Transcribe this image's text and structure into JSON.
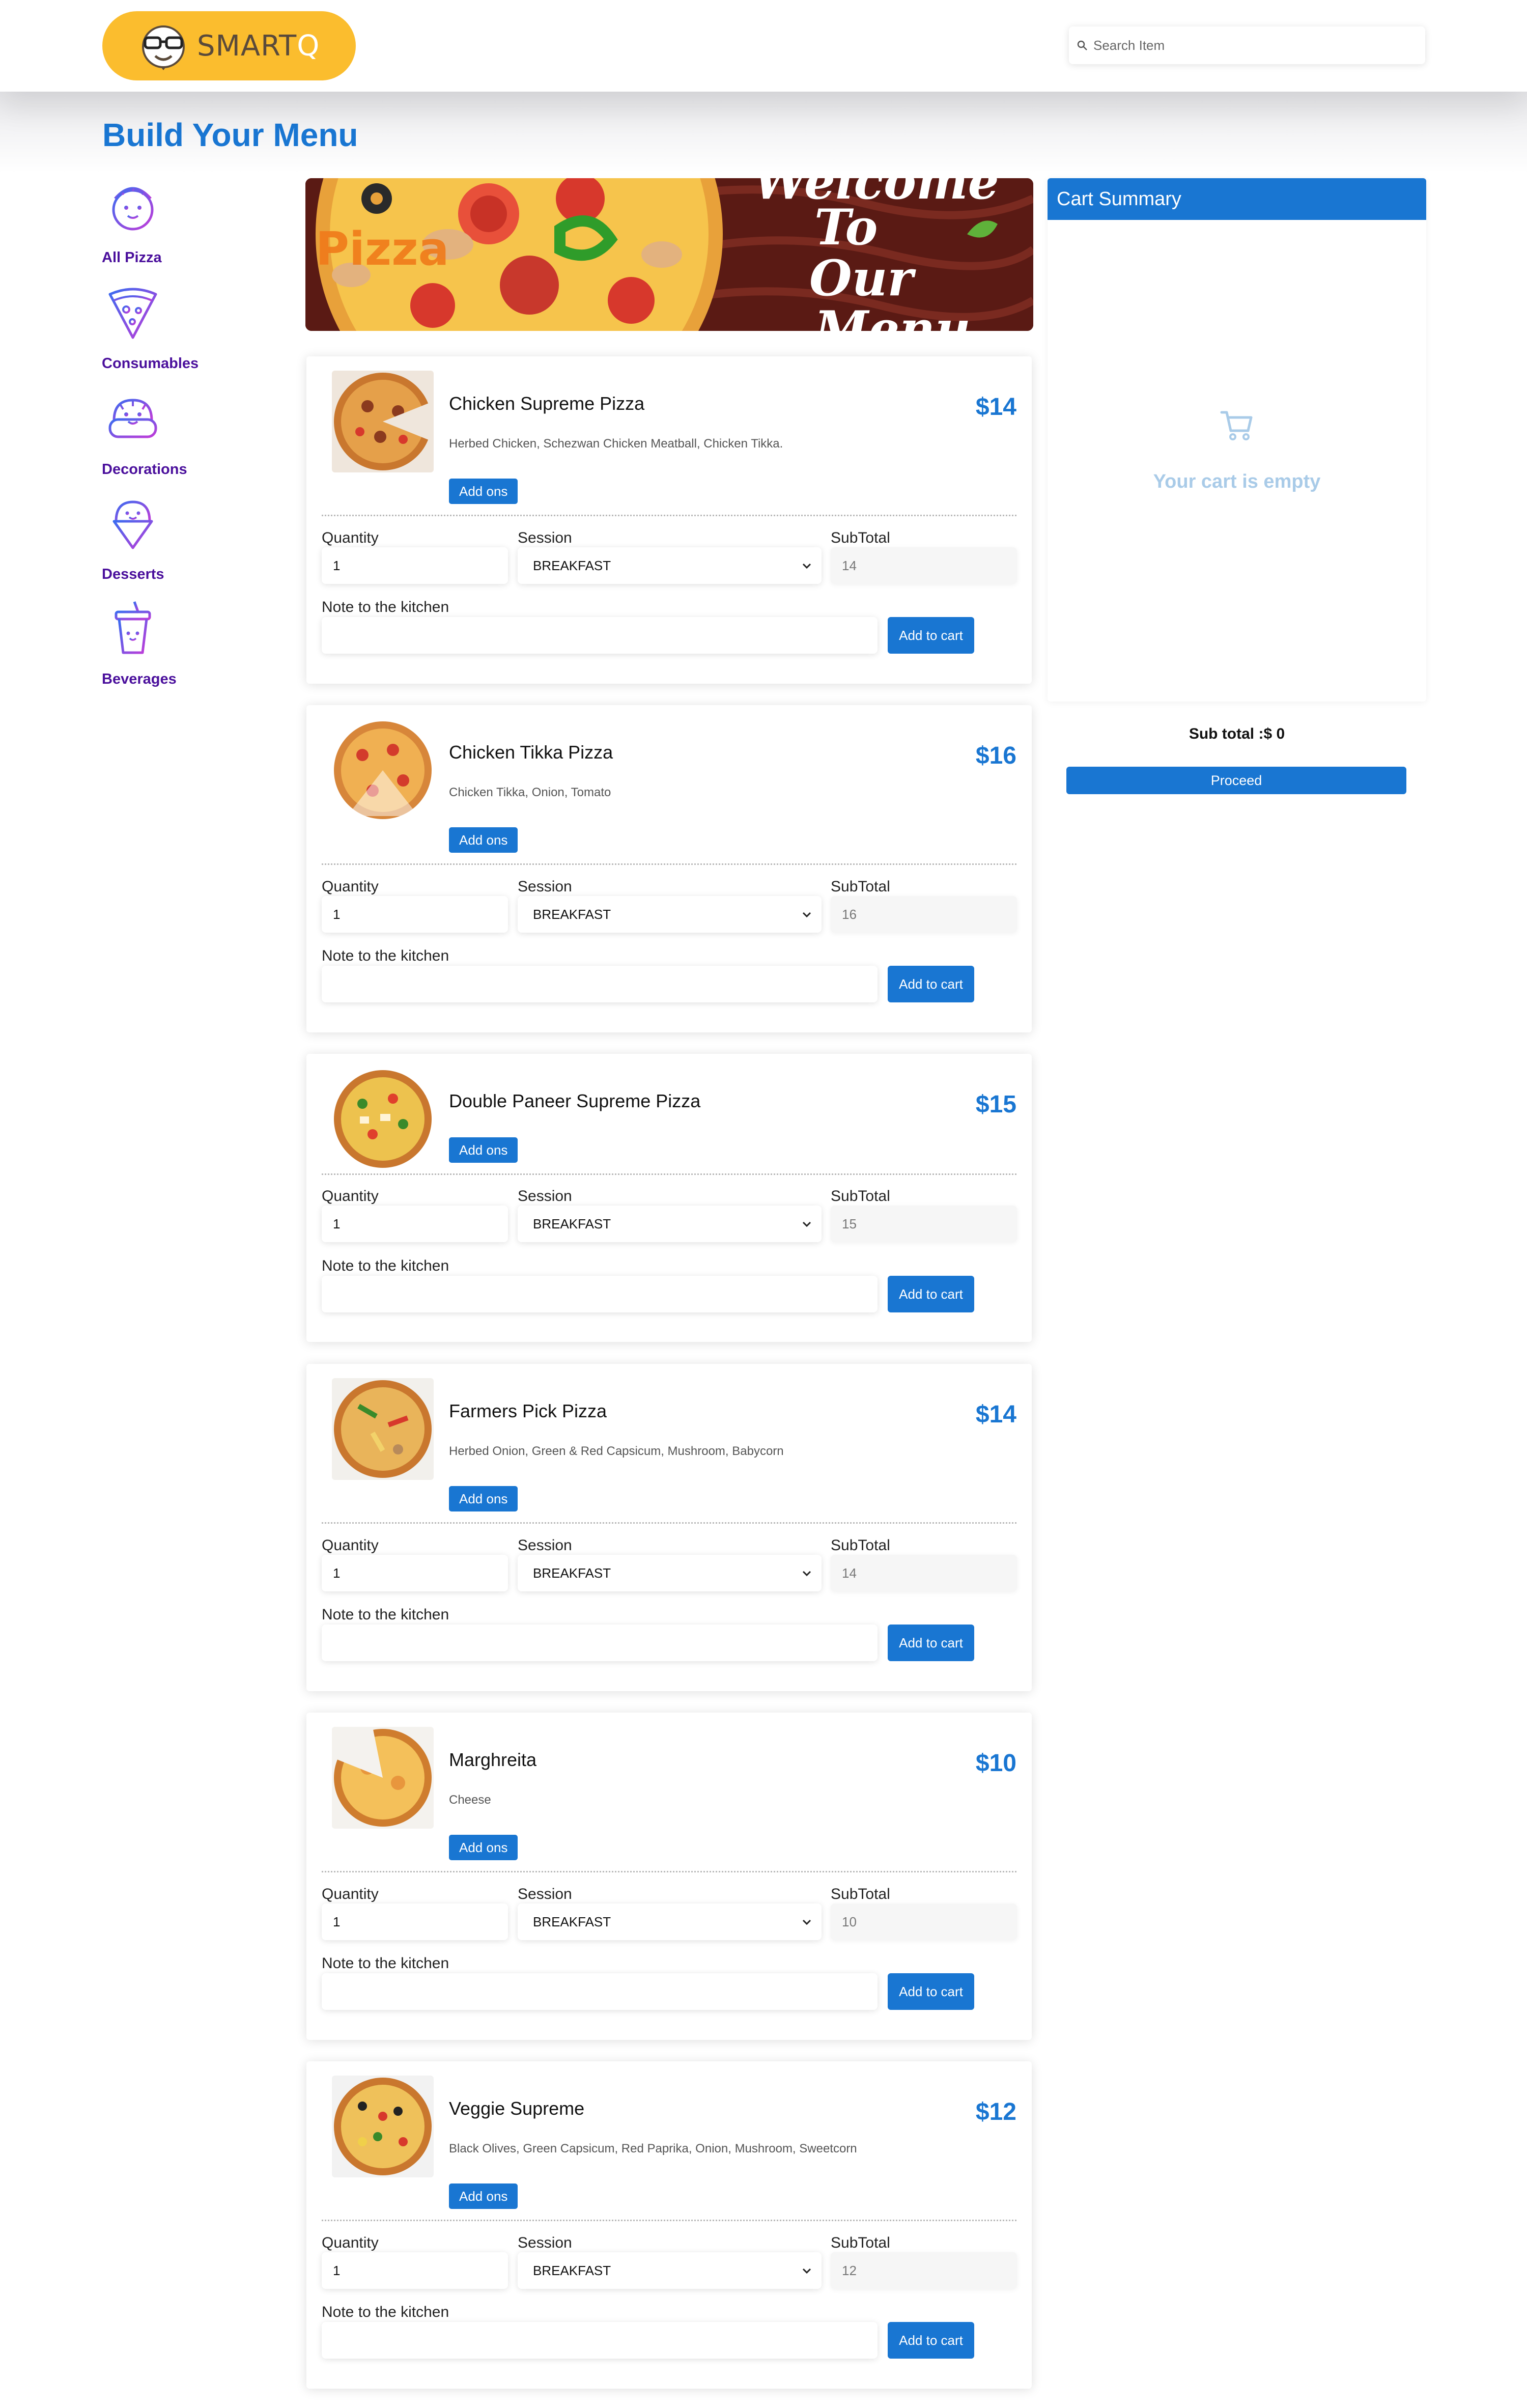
{
  "header": {
    "logo_text_main": "SMART",
    "logo_text_accent": "Q",
    "search_placeholder": "Search Item"
  },
  "page": {
    "title": "Build Your Menu"
  },
  "sidebar": {
    "items": [
      {
        "label": "All Pizza",
        "icon": "pizza-bowl-icon"
      },
      {
        "label": "Consumables",
        "icon": "pizza-slice-icon"
      },
      {
        "label": "Decorations",
        "icon": "bread-basket-icon"
      },
      {
        "label": "Desserts",
        "icon": "ice-cream-icon"
      },
      {
        "label": "Beverages",
        "icon": "drink-cup-icon"
      }
    ]
  },
  "banner": {
    "lines": [
      "Welcome",
      "To",
      "Our",
      "Menu"
    ],
    "pizza_word": "Pizza"
  },
  "labels": {
    "quantity": "Quantity",
    "session": "Session",
    "subtotal": "SubTotal",
    "note": "Note to the kitchen",
    "add_ons": "Add ons",
    "add_to_cart": "Add to cart"
  },
  "products": [
    {
      "name": "Chicken Supreme Pizza",
      "price": "$14",
      "description": "Herbed Chicken, Schezwan Chicken Meatball, Chicken Tikka.",
      "quantity": "1",
      "session": "BREAKFAST",
      "subtotal": "14"
    },
    {
      "name": "Chicken Tikka Pizza",
      "price": "$16",
      "description": "Chicken Tikka, Onion, Tomato",
      "quantity": "1",
      "session": "BREAKFAST",
      "subtotal": "16"
    },
    {
      "name": "Double Paneer Supreme Pizza",
      "price": "$15",
      "description": "",
      "quantity": "1",
      "session": "BREAKFAST",
      "subtotal": "15"
    },
    {
      "name": "Farmers Pick Pizza",
      "price": "$14",
      "description": "Herbed Onion, Green & Red Capsicum, Mushroom, Babycorn",
      "quantity": "1",
      "session": "BREAKFAST",
      "subtotal": "14"
    },
    {
      "name": "Marghreita",
      "price": "$10",
      "description": "Cheese",
      "quantity": "1",
      "session": "BREAKFAST",
      "subtotal": "10"
    },
    {
      "name": "Veggie Supreme",
      "price": "$12",
      "description": "Black Olives, Green Capsicum, Red Paprika, Onion, Mushroom, Sweetcorn",
      "quantity": "1",
      "session": "BREAKFAST",
      "subtotal": "12"
    }
  ],
  "cart": {
    "title": "Cart Summary",
    "empty_text": "Your cart is empty",
    "subtotal_text": "Sub total :$ 0",
    "proceed_label": "Proceed"
  },
  "colors": {
    "primary": "#1976d2",
    "logo_bg": "#fbbd2e",
    "category_text": "#4a0f9c"
  }
}
